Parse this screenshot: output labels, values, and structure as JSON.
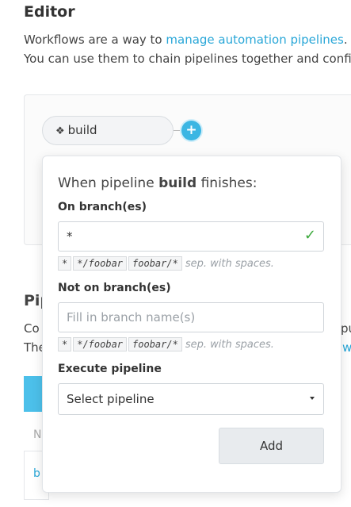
{
  "editor": {
    "title": "Editor",
    "desc_line1_pre": "Workflows are a way to ",
    "desc_line1_link": "manage automation pipelines",
    "desc_line1_post": ".",
    "desc_line2": "You can use them to chain pipelines together and configu"
  },
  "canvas": {
    "node_label": "build",
    "node_icon": "git-icon",
    "add_icon": "+"
  },
  "background": {
    "section_fragment": "Pip",
    "line1_fragment": "Co",
    "line2_fragment": "The",
    "line1_right_fragment": "pu",
    "line2_right_fragment": "w",
    "header_fragment": "N",
    "row_fragment": "b"
  },
  "popover": {
    "heading_pre": "When pipeline ",
    "heading_pipeline": "build",
    "heading_post": " finishes:",
    "on_branch_label": "On branch(es)",
    "on_branch_value": "*",
    "on_branch_chips": [
      "*",
      "*/foobar",
      "foobar/*"
    ],
    "chips_hint": "sep. with spaces.",
    "not_on_branch_label": "Not on branch(es)",
    "not_on_branch_placeholder": "Fill in branch name(s)",
    "not_on_branch_chips": [
      "*",
      "*/foobar",
      "foobar/*"
    ],
    "execute_label": "Execute pipeline",
    "execute_select": "Select pipeline",
    "add_button": "Add"
  },
  "colors": {
    "accent": "#3cb6e3",
    "link": "#2aa7d8",
    "valid": "#3aa83a"
  }
}
